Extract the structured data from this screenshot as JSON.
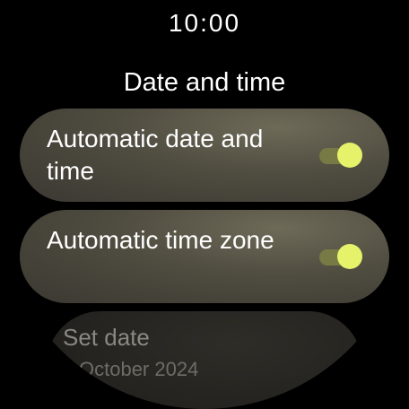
{
  "status": {
    "time": "10:00"
  },
  "page": {
    "title": "Date and time"
  },
  "settings": [
    {
      "label": "Automatic date and time",
      "checked": true
    },
    {
      "label": "Automatic time zone",
      "checked": true
    },
    {
      "label": "Set date",
      "secondary": "October 2024"
    }
  ],
  "colors": {
    "background": "#000000",
    "chip": "#4f4c40",
    "toggle_thumb": "#e5f26a",
    "toggle_track": "#777a44",
    "disabled_text": "#8a8882"
  }
}
